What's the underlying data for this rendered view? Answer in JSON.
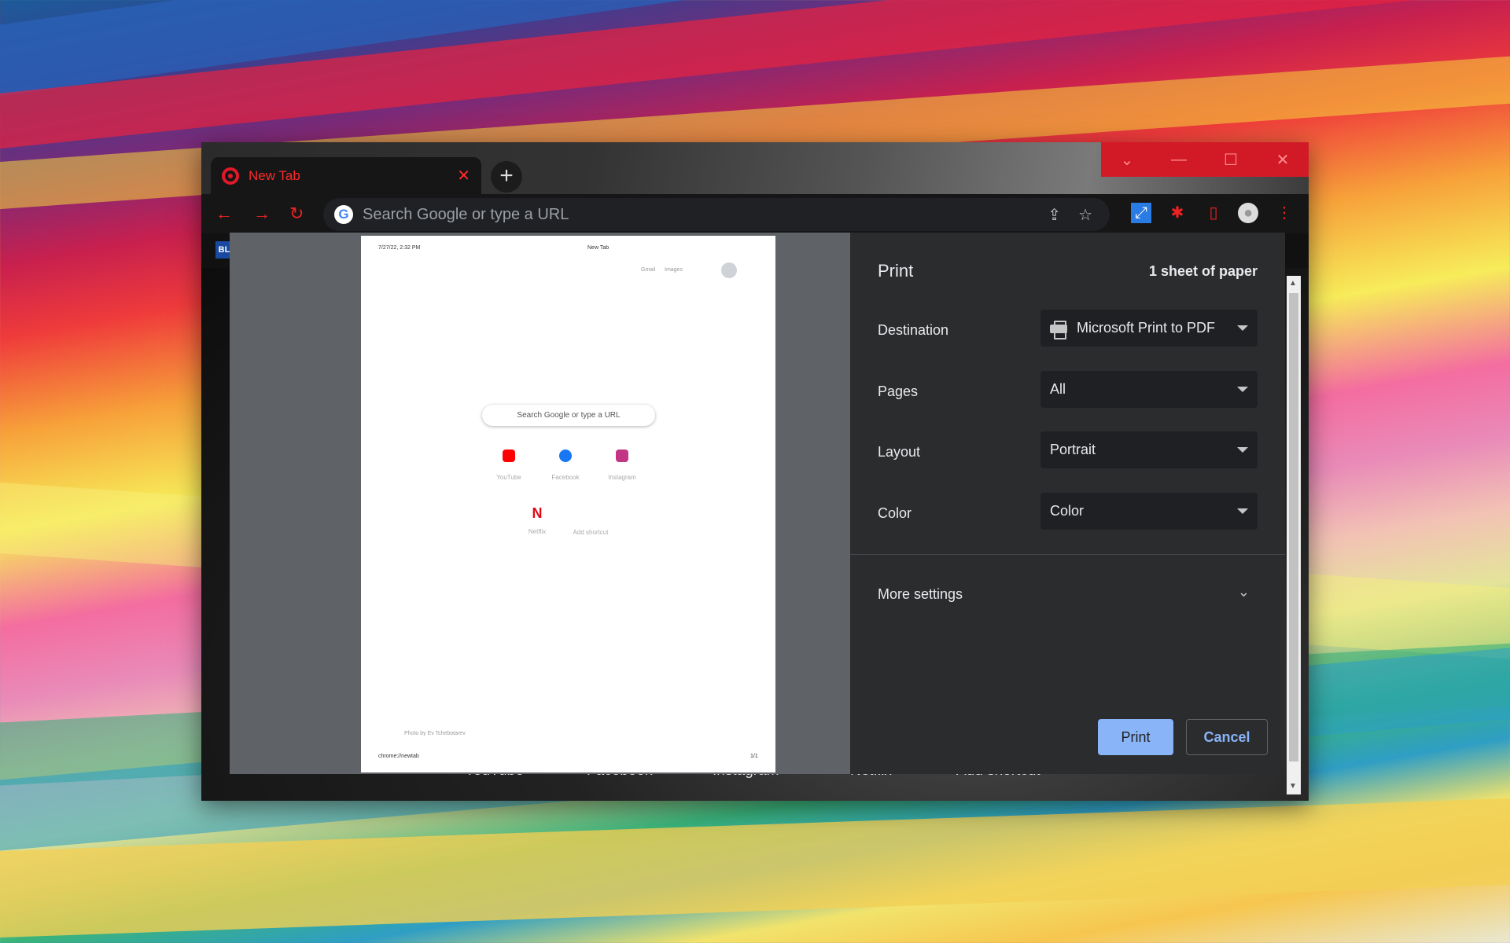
{
  "browser": {
    "tab_title": "New Tab",
    "tab_close": "✕",
    "new_tab": "+",
    "window_controls": [
      "⌄",
      "—",
      "☐",
      "✕"
    ],
    "omnibox_placeholder": "Search Google or type a URL",
    "google_letter": "G"
  },
  "background_shortcuts": [
    "YouTube",
    "Facebook",
    "Instagram",
    "Netflix",
    "Add shortcut"
  ],
  "preview": {
    "header_date": "7/27/22, 2:32 PM",
    "header_title": "New Tab",
    "link_gmail": "Gmail",
    "link_images": "Images",
    "search_placeholder": "Search Google or type a URL",
    "shortcuts": [
      {
        "label": "YouTube",
        "color": "#ff0000"
      },
      {
        "label": "Facebook",
        "color": "#1877f2"
      },
      {
        "label": "Instagram",
        "color": "#c13584"
      },
      {
        "label": "Netflix",
        "color": "#e50914"
      },
      {
        "label": "Add shortcut",
        "color": "#ffffff"
      }
    ],
    "netflix_letter": "N",
    "photo_credit": "Photo by Ev Tchebotarev",
    "footer_url": "chrome://newtab",
    "footer_page": "1/1"
  },
  "print": {
    "title": "Print",
    "sheets": "1 sheet of paper",
    "destination_label": "Destination",
    "destination_value": "Microsoft Print to PDF",
    "pages_label": "Pages",
    "pages_value": "All",
    "layout_label": "Layout",
    "layout_value": "Portrait",
    "color_label": "Color",
    "color_value": "Color",
    "more_settings": "More settings",
    "print_button": "Print",
    "cancel_button": "Cancel"
  },
  "colors": {
    "accent": "#8ab4f8",
    "browser_theme_red": "#d21a27"
  }
}
